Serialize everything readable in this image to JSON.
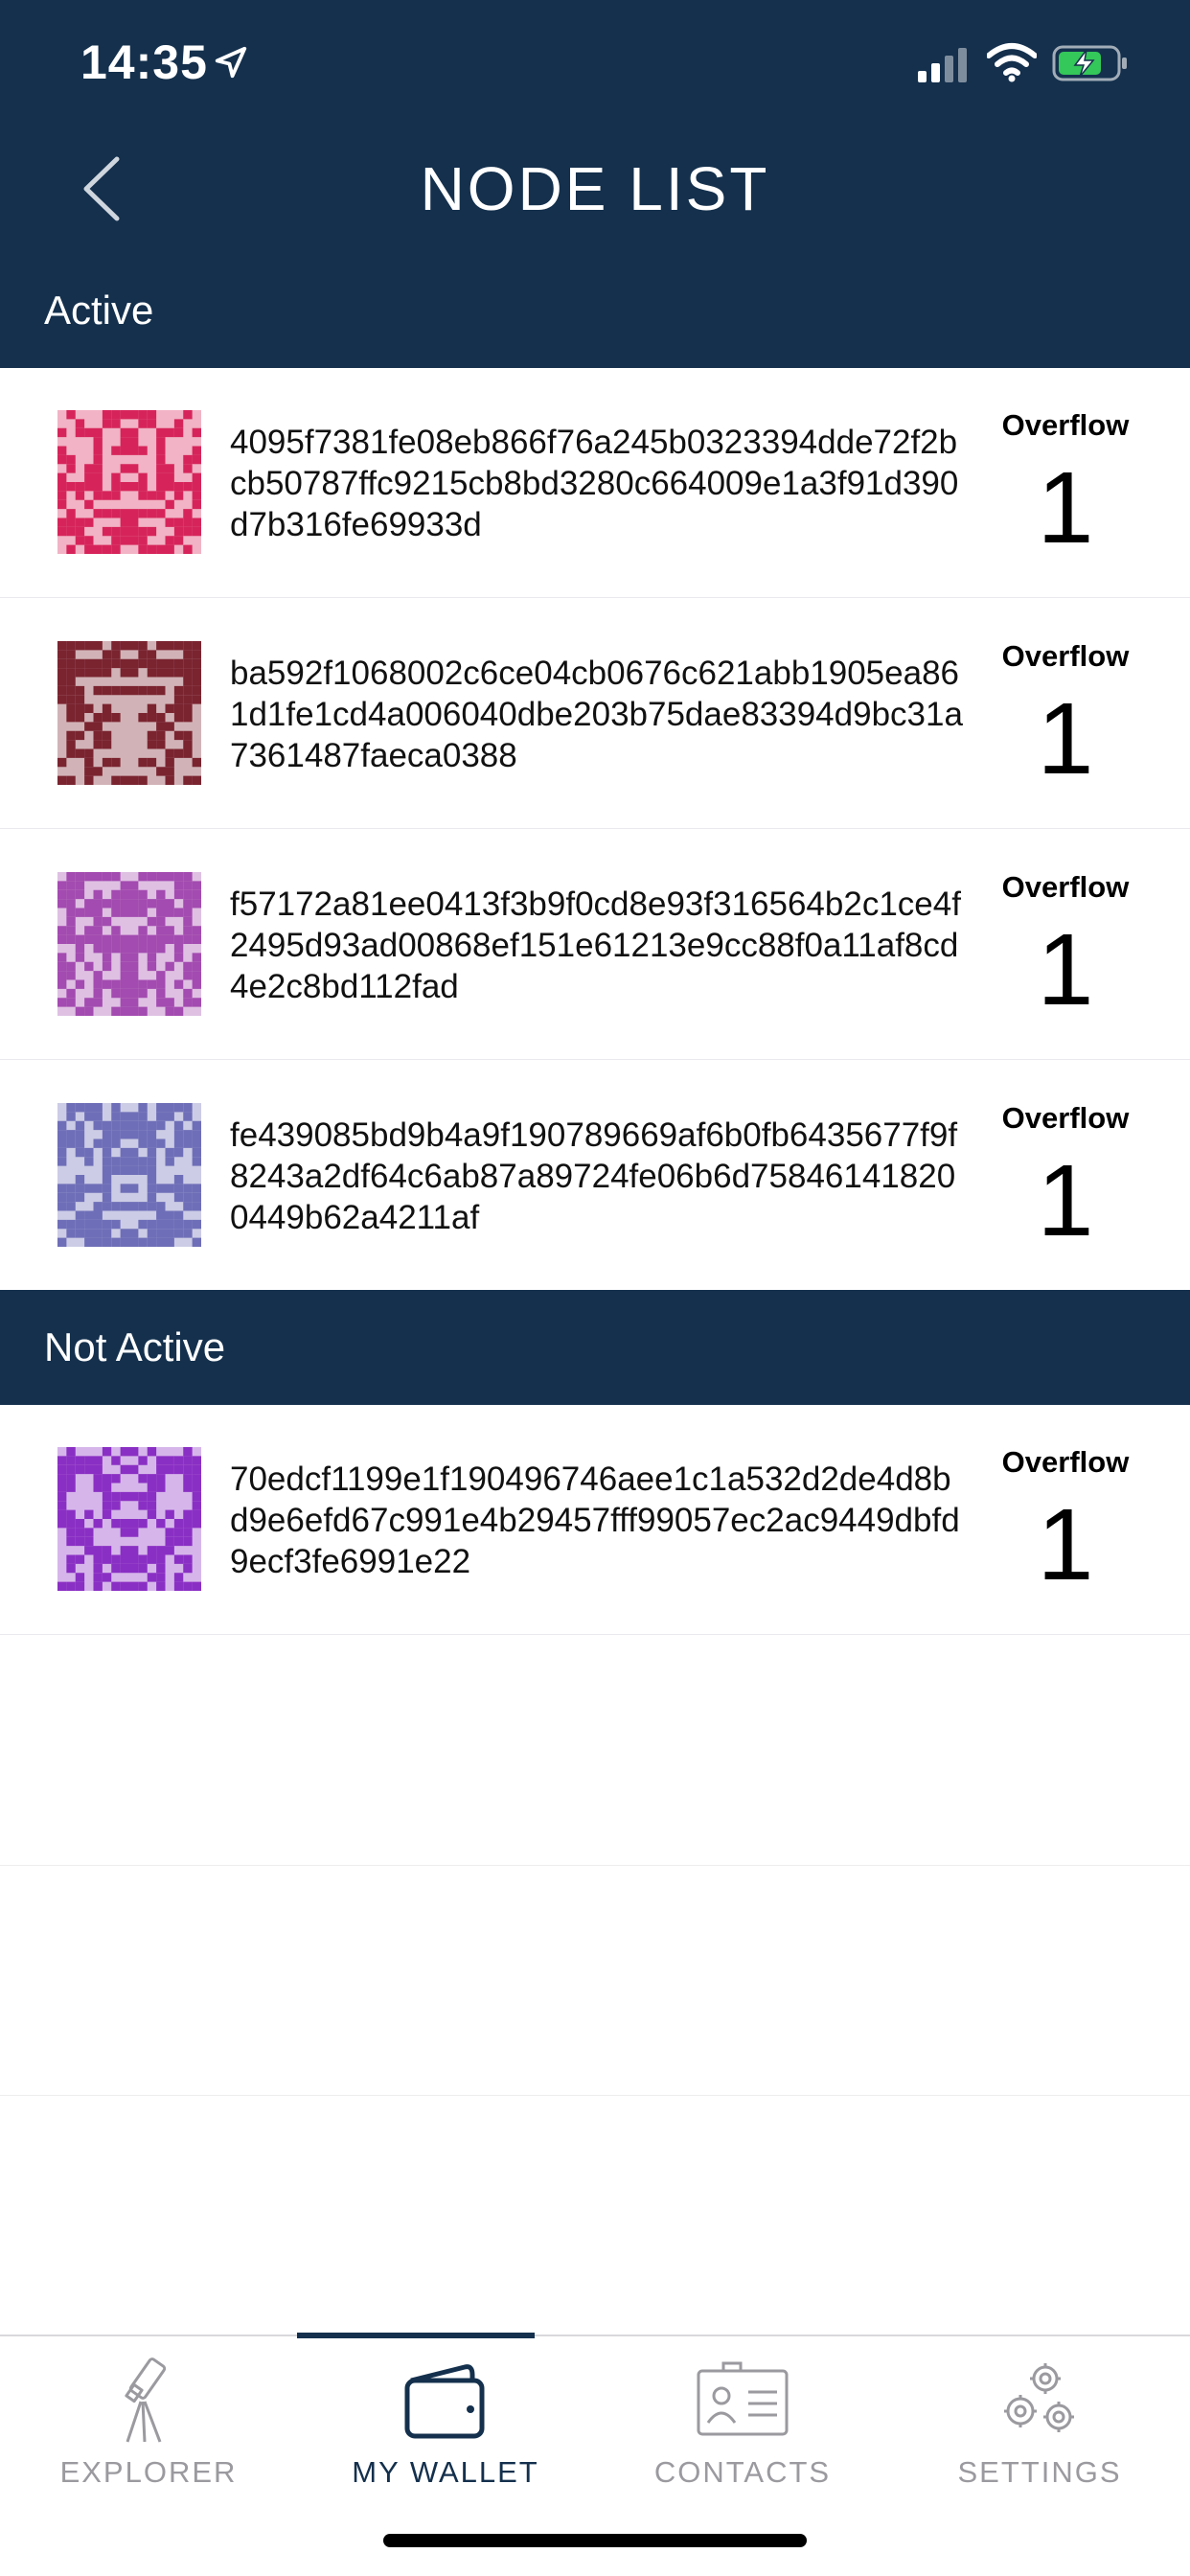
{
  "status_bar": {
    "time": "14:35"
  },
  "header": {
    "title": "NODE LIST"
  },
  "sections": {
    "active_label": "Active",
    "not_active_label": "Not Active"
  },
  "active_nodes": [
    {
      "hash": "4095f7381fe08eb866f76a245b0323394dde72f2bcb50787ffc9215cb8bd3280c664009e1a3f91d390d7b316fe69933d",
      "overflow_label": "Overflow",
      "overflow_value": "1",
      "identicon_color": "#d6245a"
    },
    {
      "hash": "ba592f1068002c6ce04cb0676c621abb1905ea861d1fe1cd4a006040dbe203b75dae83394d9bc31a7361487faeca0388",
      "overflow_label": "Overflow",
      "overflow_value": "1",
      "identicon_color": "#7a2430"
    },
    {
      "hash": "f57172a81ee0413f3b9f0cd8e93f316564b2c1ce4f2495d93ad00868ef151e61213e9cc88f0a11af8cd4e2c8bd112fad",
      "overflow_label": "Overflow",
      "overflow_value": "1",
      "identicon_color": "#a34bb0"
    },
    {
      "hash": "fe439085bd9b4a9f190789669af6b0fb6435677f9f8243a2df64c6ab87a89724fe06b6d758461418200449b62a4211af",
      "overflow_label": "Overflow",
      "overflow_value": "1",
      "identicon_color": "#6e6eb8"
    }
  ],
  "inactive_nodes": [
    {
      "hash": "70edcf1199e1f190496746aee1c1a532d2de4d8bd9e6efd67c991e4b29457fff99057ec2ac9449dbfd9ecf3fe6991e22",
      "overflow_label": "Overflow",
      "overflow_value": "1",
      "identicon_color": "#8a2fc4"
    }
  ],
  "tabbar": {
    "tabs": [
      {
        "label": "EXPLORER",
        "icon": "telescope-icon"
      },
      {
        "label": "MY WALLET",
        "icon": "wallet-icon"
      },
      {
        "label": "CONTACTS",
        "icon": "contact-card-icon"
      },
      {
        "label": "SETTINGS",
        "icon": "gears-icon"
      }
    ],
    "active_tab": "MY WALLET"
  },
  "colors": {
    "header_bg": "#14304d",
    "inactive_tab": "#9a9a9f"
  }
}
